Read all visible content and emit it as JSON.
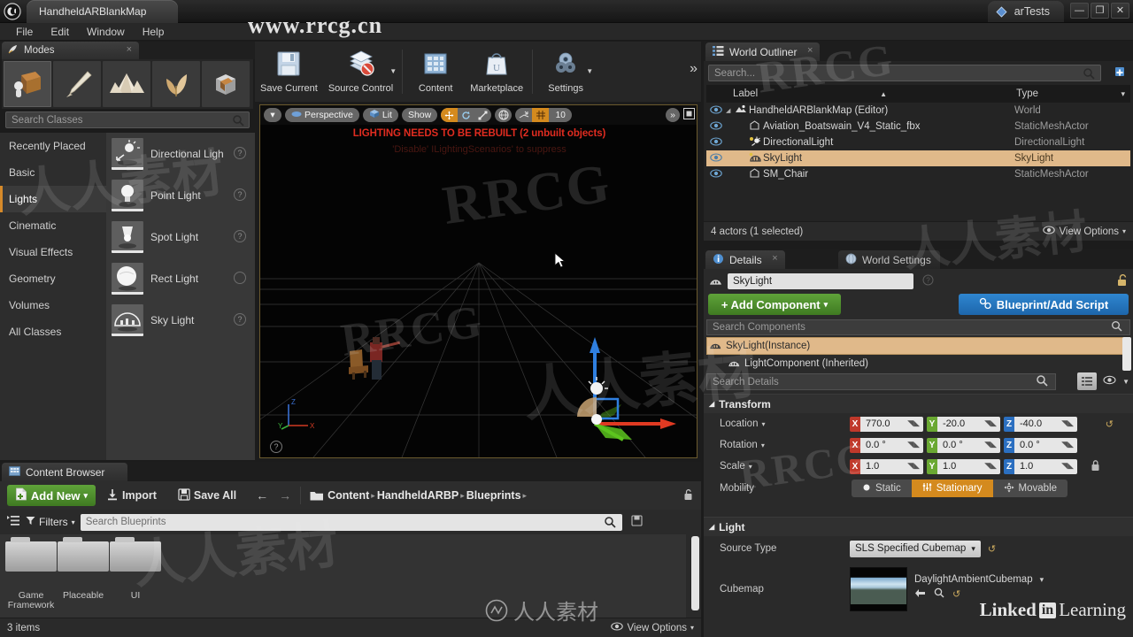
{
  "titlebar": {
    "project_tab": "HandheldARBlankMap",
    "right_tab": "arTests",
    "minimize": "—",
    "maximize": "❐",
    "close": "✕"
  },
  "menubar": {
    "items": [
      "File",
      "Edit",
      "Window",
      "Help"
    ]
  },
  "modes_panel": {
    "tab_label": "Modes",
    "tab_close": "×",
    "mode_icons": [
      "place-mode-icon",
      "paint-mode-icon",
      "landscape-mode-icon",
      "foliage-mode-icon",
      "geometry-edit-mode-icon"
    ],
    "search_placeholder": "Search Classes",
    "categories": [
      {
        "label": "Recently Placed",
        "active": false
      },
      {
        "label": "Basic",
        "active": false
      },
      {
        "label": "Lights",
        "active": true
      },
      {
        "label": "Cinematic",
        "active": false
      },
      {
        "label": "Visual Effects",
        "active": false
      },
      {
        "label": "Geometry",
        "active": false
      },
      {
        "label": "Volumes",
        "active": false
      },
      {
        "label": "All Classes",
        "active": false
      }
    ],
    "placeables": [
      {
        "label": "Directional Ligh",
        "help": "?"
      },
      {
        "label": "Point Light",
        "help": "?"
      },
      {
        "label": "Spot Light",
        "help": "?"
      },
      {
        "label": "Rect Light",
        "help": ""
      },
      {
        "label": "Sky Light",
        "help": "?"
      }
    ]
  },
  "main_toolbar": {
    "items": [
      {
        "label": "Save Current",
        "icon": "save-icon",
        "caret": false
      },
      {
        "label": "Source Control",
        "icon": "source-control-icon",
        "caret": true
      },
      {
        "label": "Content",
        "icon": "content-icon",
        "caret": false
      },
      {
        "label": "Marketplace",
        "icon": "marketplace-icon",
        "caret": false
      },
      {
        "label": "Settings",
        "icon": "settings-gear-icon",
        "caret": true
      }
    ],
    "overflow": "»"
  },
  "viewport": {
    "camera_dropdown": "▾",
    "perspective": "Perspective",
    "view_mode": "Lit",
    "show": "Show",
    "transform_tools": [
      "move-gizmo-icon",
      "rotate-gizmo-icon",
      "scale-gizmo-icon"
    ],
    "world_coord": "world-space-icon",
    "surface_snap": "surface-snap-icon",
    "grid_snap": "grid-snap-icon",
    "grid_size": "10",
    "overflow": "»",
    "maximize": "❐",
    "warning_line1": "LIGHTING NEEDS TO BE REBUILT (2 unbuilt objects)",
    "warning_line2": "'Disable' ILightingScenarios' to suppress",
    "axis_x": "X",
    "axis_y": "Y",
    "axis_z": "Z",
    "help": "?"
  },
  "outliner": {
    "tab_label": "World Outliner",
    "tab_close": "×",
    "search_placeholder": "Search...",
    "add_button": "➕",
    "columns": {
      "label": "Label",
      "type": "Type",
      "sort_arrow": "▲",
      "filter": "▾"
    },
    "rows": [
      {
        "label": "HandheldARBlankMap (Editor)",
        "type": "World",
        "indent": 0,
        "icon": "world-icon",
        "selected": false,
        "expander": "◢"
      },
      {
        "label": "Aviation_Boatswain_V4_Static_fbx",
        "type": "StaticMeshActor",
        "indent": 1,
        "icon": "static-mesh-icon",
        "selected": false,
        "expander": ""
      },
      {
        "label": "DirectionalLight",
        "type": "DirectionalLight",
        "indent": 1,
        "icon": "directional-light-icon",
        "selected": false,
        "expander": ""
      },
      {
        "label": "SkyLight",
        "type": "SkyLight",
        "indent": 1,
        "icon": "sky-light-icon",
        "selected": true,
        "expander": ""
      },
      {
        "label": "SM_Chair",
        "type": "StaticMeshActor",
        "indent": 1,
        "icon": "static-mesh-icon",
        "selected": false,
        "expander": ""
      }
    ],
    "footer_status": "4 actors (1 selected)",
    "view_options": "View Options",
    "view_options_caret": "▾"
  },
  "details": {
    "tab_details": "Details",
    "tab_details_close": "×",
    "tab_world_settings": "World Settings",
    "actor_name": "SkyLight",
    "lock_icon": "unlocked-padlock-icon",
    "add_component_label": "+ Add Component",
    "add_component_caret": "▾",
    "blueprint_label": "Blueprint/Add Script",
    "component_search_placeholder": "Search Components",
    "components": [
      {
        "label": "SkyLight(Instance)",
        "selected": true,
        "indent": 0
      },
      {
        "label": "LightComponent (Inherited)",
        "selected": false,
        "indent": 1
      }
    ],
    "details_search_placeholder": "Search Details",
    "sections": {
      "transform": {
        "title": "Transform",
        "collapse_arrow": "◢",
        "location": {
          "label": "Location",
          "caret": "▾",
          "x": "770.0",
          "y": "-20.0",
          "z": "-40.0",
          "reset": "↺"
        },
        "rotation": {
          "label": "Rotation",
          "caret": "▾",
          "x": "0.0 °",
          "y": "0.0 °",
          "z": "0.0 °"
        },
        "scale": {
          "label": "Scale",
          "caret": "▾",
          "x": "1.0",
          "y": "1.0",
          "z": "1.0",
          "lock": "🔒"
        },
        "mobility": {
          "label": "Mobility",
          "options": [
            {
              "label": "Static",
              "active": false
            },
            {
              "label": "Stationary",
              "active": true
            },
            {
              "label": "Movable",
              "active": false
            }
          ]
        }
      },
      "light": {
        "title": "Light",
        "collapse_arrow": "◢",
        "source_type": {
          "label": "Source Type",
          "value": "SLS Specified Cubemap",
          "caret": "▾",
          "reset": "↺"
        },
        "cubemap": {
          "label": "Cubemap",
          "value": "DaylightAmbientCubemap",
          "caret": "▾",
          "actions": [
            "browse-back-icon",
            "find-in-content-icon",
            "reset-icon"
          ]
        }
      }
    },
    "axis_tags": {
      "x": "X",
      "y": "Y",
      "z": "Z"
    }
  },
  "content_browser": {
    "tab_label": "Content Browser",
    "add_new": "Add New",
    "add_new_caret": "▾",
    "import": "Import",
    "save_all": "Save All",
    "nav_back": "←",
    "nav_forward": "→",
    "breadcrumbs": [
      "Content",
      "HandheldARBP",
      "Blueprints"
    ],
    "breadcrumb_arrow": "▸",
    "lock_icon": "unlocked-padlock-icon",
    "filters_label": "Filters",
    "filters_caret": "▾",
    "search_placeholder": "Search Blueprints",
    "folders": [
      "Game Framework",
      "Placeable",
      "UI"
    ],
    "footer_count": "3 items",
    "view_options": "View Options",
    "view_options_caret": "▾"
  },
  "watermarks": {
    "top_url": "www.rrcg.cn",
    "rrcg": "RRCG",
    "chinese": "人人素材",
    "linkedin": "Linked",
    "linkedin_in": "in",
    "linkedin_learning": "Learning"
  },
  "colors": {
    "accent_orange": "#d48a1e",
    "selection": "#e0b98a",
    "green_button": "#4f9128",
    "blue_button": "#2373b8",
    "warning_red": "#e02c20",
    "axis_x": "#c0392b",
    "axis_y": "#6aa832",
    "axis_z": "#2b6fc0"
  }
}
